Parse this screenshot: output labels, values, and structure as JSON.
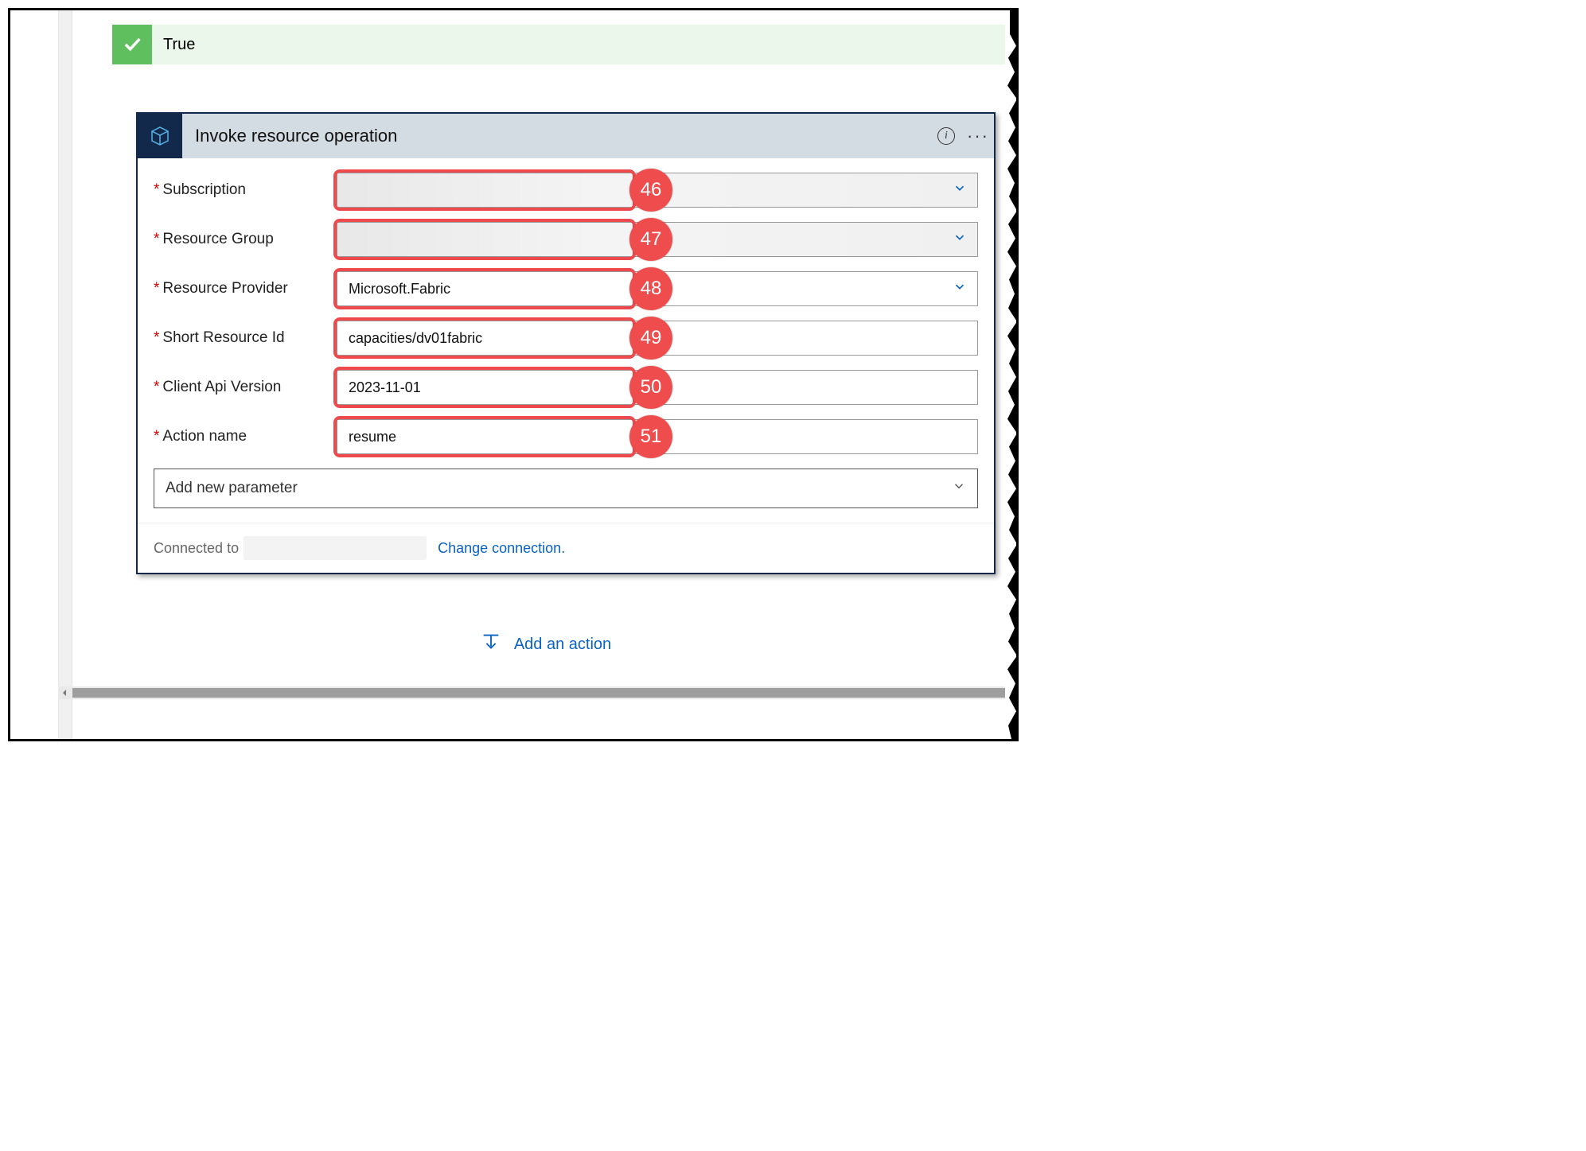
{
  "condition": {
    "label": "True"
  },
  "action": {
    "title": "Invoke resource operation",
    "fields": [
      {
        "label": "Subscription",
        "value": "",
        "has_dropdown": true,
        "callout": "46",
        "blurred": true
      },
      {
        "label": "Resource Group",
        "value": "",
        "has_dropdown": true,
        "callout": "47",
        "blurred": true
      },
      {
        "label": "Resource Provider",
        "value": "Microsoft.Fabric",
        "has_dropdown": true,
        "callout": "48",
        "blurred": false
      },
      {
        "label": "Short Resource Id",
        "value": "capacities/dv01fabric",
        "has_dropdown": false,
        "callout": "49",
        "blurred": false
      },
      {
        "label": "Client Api Version",
        "value": "2023-11-01",
        "has_dropdown": false,
        "callout": "50",
        "blurred": false
      },
      {
        "label": "Action name",
        "value": "resume",
        "has_dropdown": false,
        "callout": "51",
        "blurred": false
      }
    ],
    "add_param_label": "Add new parameter",
    "connected_label": "Connected to",
    "change_connection_label": "Change connection."
  },
  "add_action_label": "Add an action"
}
